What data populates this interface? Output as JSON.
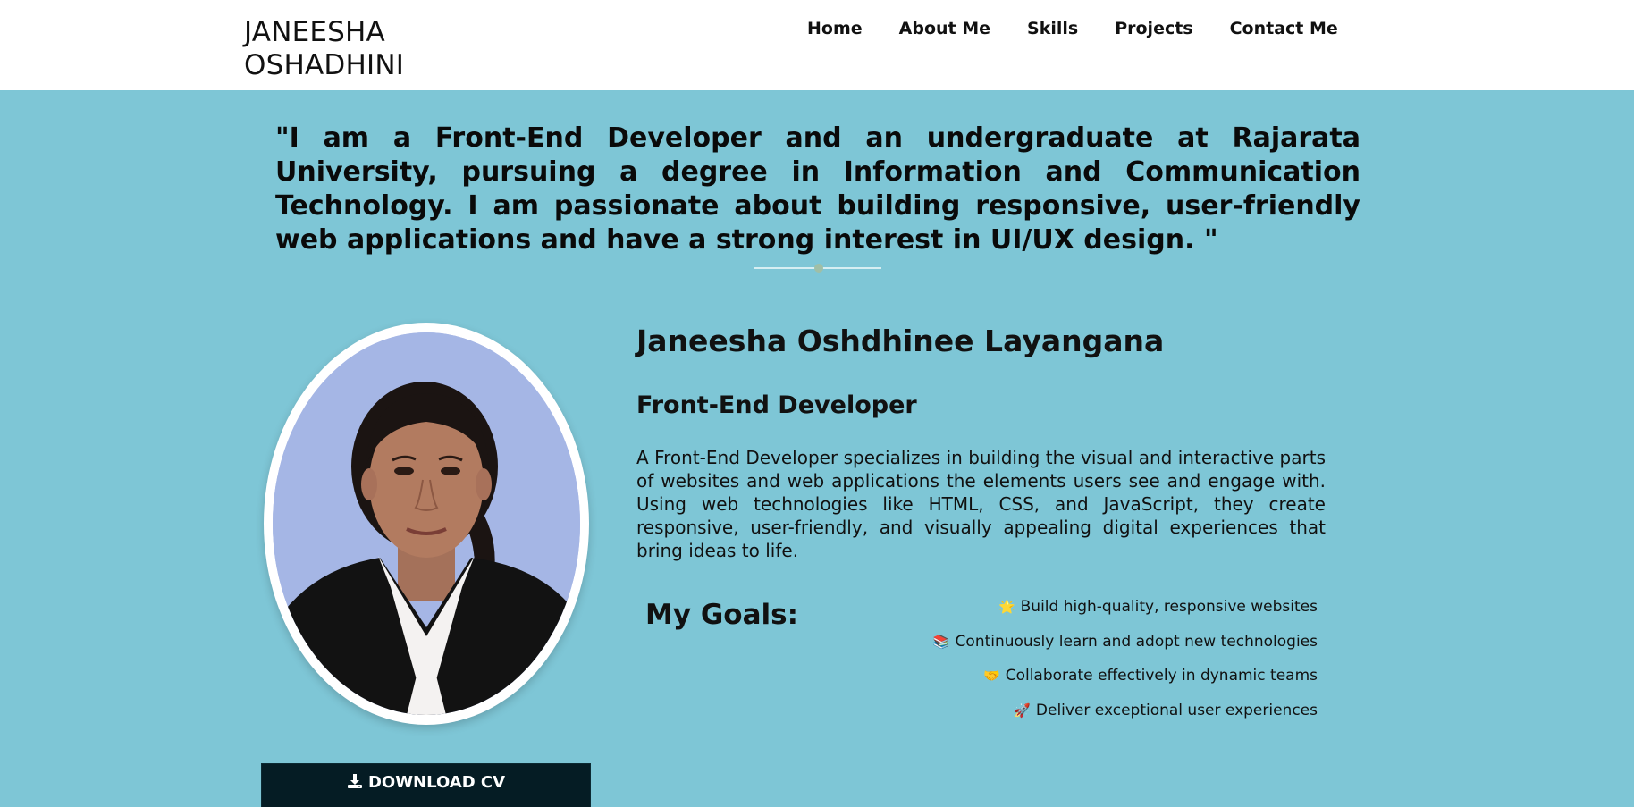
{
  "header": {
    "brand_line1": "JANEESHA",
    "brand_line2": "OSHADHINI",
    "nav": [
      {
        "label": "Home"
      },
      {
        "label": "About Me"
      },
      {
        "label": "Skills"
      },
      {
        "label": "Projects"
      },
      {
        "label": "Contact Me"
      }
    ]
  },
  "quote": "\"I am a Front-End Developer and an undergraduate at Rajarata University, pursuing a degree in Information and Communication Technology. I am passionate about building responsive, user-friendly web applications and have a strong interest in UI/UX design. \"",
  "profile": {
    "full_name": "Janeesha Oshdhinee Layangana",
    "role": "Front-End Developer",
    "description": "A Front-End Developer specializes in building the visual and interactive parts of websites and web applications the elements users see and engage with. Using web technologies like HTML, CSS, and JavaScript, they create responsive, user-friendly, and visually appealing digital experiences that bring ideas to life.",
    "download_cv_label": "DOWNLOAD CV"
  },
  "goals": {
    "title": "My Goals:",
    "items": [
      {
        "icon": "🌟",
        "icon_name": "star-icon",
        "text": "Build high-quality, responsive websites"
      },
      {
        "icon": "📚",
        "icon_name": "books-icon",
        "text": "Continuously learn and adopt new technologies"
      },
      {
        "icon": "🤝",
        "icon_name": "handshake-icon",
        "text": "Collaborate effectively in dynamic teams"
      },
      {
        "icon": "🚀",
        "icon_name": "rocket-icon",
        "text": "Deliver exceptional user experiences"
      }
    ]
  },
  "colors": {
    "page_background": "#7ec6d6",
    "header_background": "#ffffff",
    "button_background": "#051c24"
  }
}
